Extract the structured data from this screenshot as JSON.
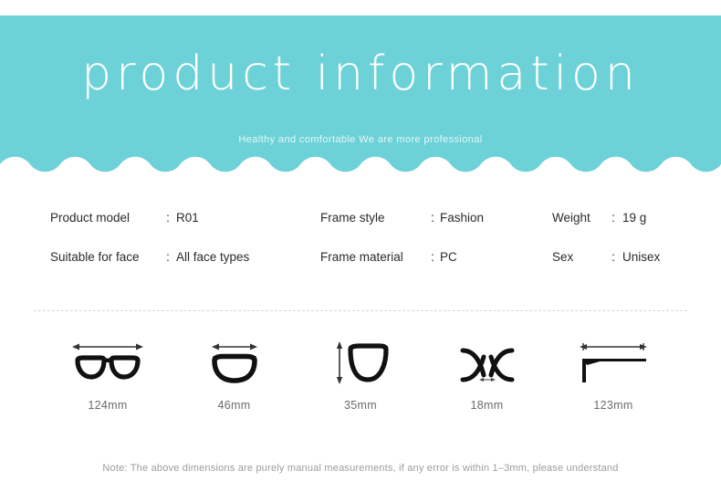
{
  "header": {
    "title": "product information",
    "subtitle": "Healthy and comfortable We are more professional",
    "background_color": "#6CD2D8",
    "title_color": "#FFFFFF"
  },
  "specs": {
    "rows": [
      [
        {
          "label": "Product model",
          "colon": ":",
          "value": "R01"
        },
        {
          "label": "Frame style",
          "colon": ":",
          "value": "Fashion"
        },
        {
          "label": "Weight",
          "colon": ":",
          "value": "19 g"
        }
      ],
      [
        {
          "label": "Suitable for face",
          "colon": ":",
          "value": "All face types"
        },
        {
          "label": "Frame material",
          "colon": ":",
          "value": "PC"
        },
        {
          "label": "Sex",
          "colon": ":",
          "value": "Unisex"
        }
      ]
    ]
  },
  "measurements": [
    {
      "icon": "glasses-front-full-width-icon",
      "label": "124mm"
    },
    {
      "icon": "glasses-lens-width-icon",
      "label": "46mm"
    },
    {
      "icon": "glasses-lens-height-icon",
      "label": "35mm"
    },
    {
      "icon": "glasses-bridge-width-icon",
      "label": "18mm"
    },
    {
      "icon": "glasses-temple-length-icon",
      "label": "123mm"
    }
  ],
  "note": "Note: The above dimensions are purely manual measurements, if any error is within 1–3mm, please understand"
}
